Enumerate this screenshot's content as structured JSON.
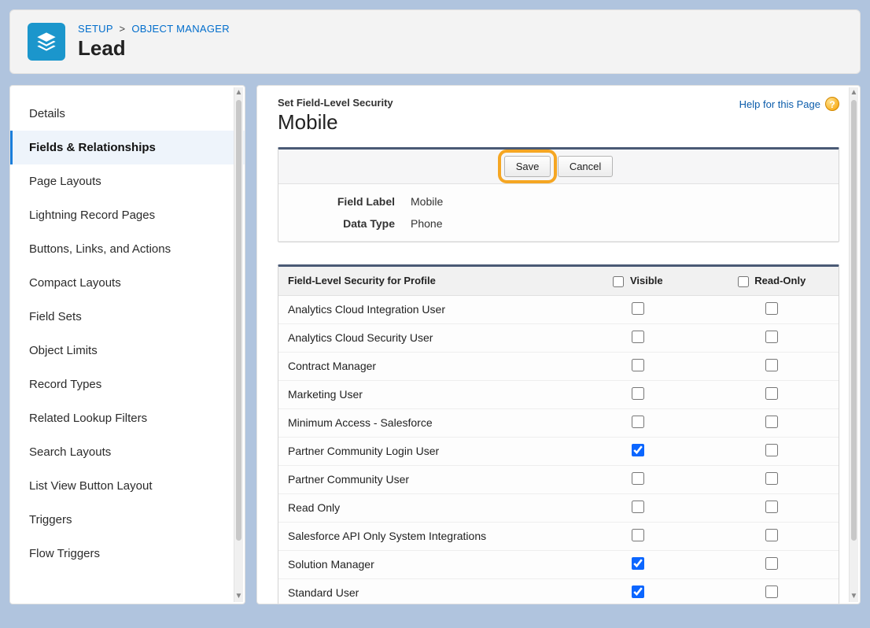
{
  "breadcrumb": {
    "setup": "SETUP",
    "object_manager": "OBJECT MANAGER"
  },
  "page_title": "Lead",
  "sidebar": {
    "items": [
      {
        "label": "Details"
      },
      {
        "label": "Fields & Relationships",
        "active": true
      },
      {
        "label": "Page Layouts"
      },
      {
        "label": "Lightning Record Pages"
      },
      {
        "label": "Buttons, Links, and Actions"
      },
      {
        "label": "Compact Layouts"
      },
      {
        "label": "Field Sets"
      },
      {
        "label": "Object Limits"
      },
      {
        "label": "Record Types"
      },
      {
        "label": "Related Lookup Filters"
      },
      {
        "label": "Search Layouts"
      },
      {
        "label": "List View Button Layout"
      },
      {
        "label": "Triggers"
      },
      {
        "label": "Flow Triggers"
      }
    ]
  },
  "main": {
    "section_label": "Set Field-Level Security",
    "section_title": "Mobile",
    "help_link": "Help for this Page",
    "buttons": {
      "save": "Save",
      "cancel": "Cancel"
    },
    "field_info": {
      "field_label_caption": "Field Label",
      "field_label_value": "Mobile",
      "data_type_caption": "Data Type",
      "data_type_value": "Phone"
    },
    "fls": {
      "header": {
        "profile": "Field-Level Security for Profile",
        "visible": "Visible",
        "readonly": "Read-Only"
      },
      "rows": [
        {
          "profile": "Analytics Cloud Integration User",
          "visible": false,
          "readonly": false
        },
        {
          "profile": "Analytics Cloud Security User",
          "visible": false,
          "readonly": false
        },
        {
          "profile": "Contract Manager",
          "visible": false,
          "readonly": false
        },
        {
          "profile": "Marketing User",
          "visible": false,
          "readonly": false
        },
        {
          "profile": "Minimum Access - Salesforce",
          "visible": false,
          "readonly": false
        },
        {
          "profile": "Partner Community Login User",
          "visible": true,
          "readonly": false
        },
        {
          "profile": "Partner Community User",
          "visible": false,
          "readonly": false
        },
        {
          "profile": "Read Only",
          "visible": false,
          "readonly": false
        },
        {
          "profile": "Salesforce API Only System Integrations",
          "visible": false,
          "readonly": false
        },
        {
          "profile": "Solution Manager",
          "visible": true,
          "readonly": false
        },
        {
          "profile": "Standard User",
          "visible": true,
          "readonly": false
        }
      ]
    }
  }
}
